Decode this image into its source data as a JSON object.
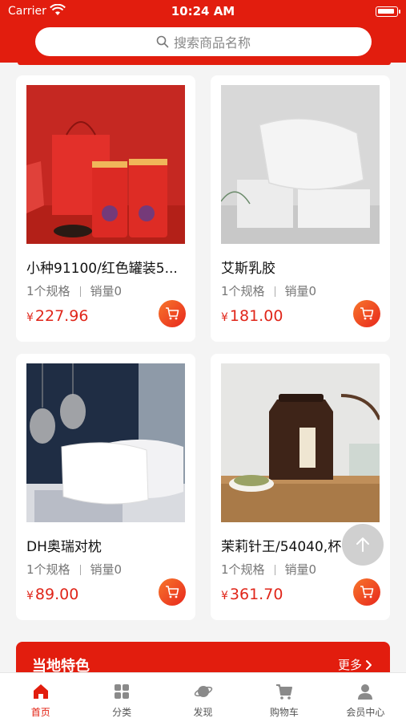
{
  "status_bar": {
    "carrier": "Carrier",
    "time": "10:24 AM"
  },
  "search": {
    "placeholder": "搜索商品名称"
  },
  "products": [
    {
      "name": "小种91100/红色罐装5...",
      "spec": "1个规格",
      "sales": "销量0",
      "currency": "¥",
      "price": "227.96"
    },
    {
      "name": "艾斯乳胶",
      "spec": "1个规格",
      "sales": "销量0",
      "currency": "¥",
      "price": "181.00"
    },
    {
      "name": "DH奥瑞对枕",
      "spec": "1个规格",
      "sales": "销量0",
      "currency": "¥",
      "price": "89.00"
    },
    {
      "name": "茉莉针王/54040,杯",
      "spec": "1个规格",
      "sales": "销量0",
      "currency": "¥",
      "price": "361.70"
    }
  ],
  "local_section": {
    "title": "当地特色",
    "more": "更多"
  },
  "tabs": [
    {
      "label": "首页",
      "icon": "home-icon",
      "active": true
    },
    {
      "label": "分类",
      "icon": "grid-icon"
    },
    {
      "label": "发现",
      "icon": "planet-icon"
    },
    {
      "label": "购物车",
      "icon": "cart-icon"
    },
    {
      "label": "会员中心",
      "icon": "user-icon"
    }
  ],
  "colors": {
    "brand": "#e21d0e",
    "price": "#e0261a",
    "cart_button": "#f05a22"
  }
}
